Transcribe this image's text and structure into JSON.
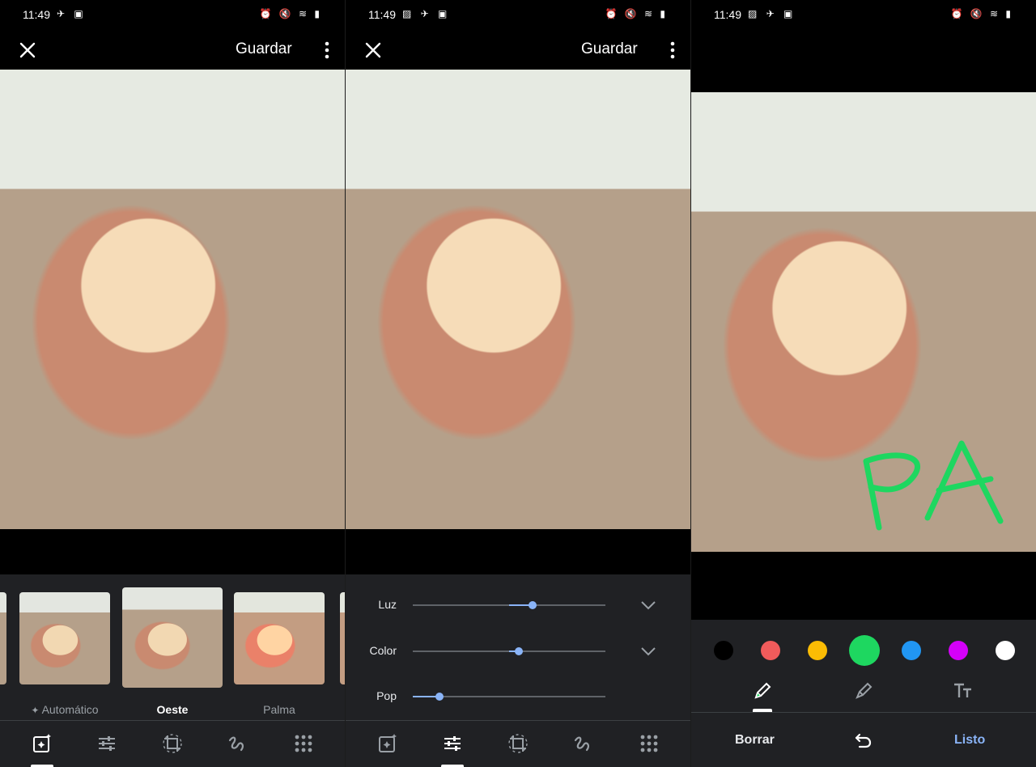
{
  "status_bar": {
    "time": "11:49"
  },
  "top_bar": {
    "save_label": "Guardar"
  },
  "filters": {
    "items": [
      {
        "label": "Automático",
        "selected": false
      },
      {
        "label": "Oeste",
        "selected": true
      },
      {
        "label": "Palma",
        "selected": false
      }
    ]
  },
  "adjust": {
    "sliders": [
      {
        "label": "Luz",
        "value": 0.62,
        "has_expand": true
      },
      {
        "label": "Color",
        "value": 0.55,
        "has_expand": true
      },
      {
        "label": "Pop",
        "value": 0.14,
        "has_expand": false
      }
    ],
    "accent": "#8ab4f8"
  },
  "markup": {
    "drawn_text": "PA",
    "pen_color": "#1ed760",
    "colors": [
      {
        "name": "black",
        "hex": "#000000"
      },
      {
        "name": "red",
        "hex": "#f15b5b"
      },
      {
        "name": "yellow",
        "hex": "#fbbc04"
      },
      {
        "name": "green",
        "hex": "#1ed760",
        "selected": true
      },
      {
        "name": "blue",
        "hex": "#2196f3"
      },
      {
        "name": "magenta",
        "hex": "#d500f9"
      },
      {
        "name": "white",
        "hex": "#ffffff"
      }
    ],
    "clear_label": "Borrar",
    "done_label": "Listo",
    "done_color": "#8ab4f8"
  },
  "icons": {
    "toolbar": [
      "suggestions-icon",
      "adjust-icon",
      "crop-rotate-icon",
      "markup-icon",
      "more-tools-icon"
    ],
    "markup_modes": [
      "pen-icon",
      "highlighter-icon",
      "text-icon"
    ]
  }
}
